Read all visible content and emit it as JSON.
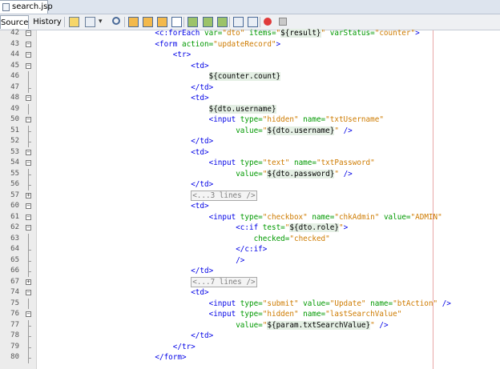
{
  "file_tab": {
    "name": "search.jsp"
  },
  "toolbar": {
    "source_label": "Source",
    "history_label": "History",
    "icons": [
      "back-icon",
      "forward-icon",
      "dropdown-icon",
      "search-icon",
      "find-previous-icon",
      "find-next-icon",
      "find-selection-icon",
      "toggle-highlight-icon",
      "prev-bookmark-icon",
      "next-bookmark-icon",
      "toggle-bookmark-icon",
      "shift-left-icon",
      "shift-right-icon",
      "record-macro-icon",
      "stop-macro-icon"
    ]
  },
  "colors": {
    "tag": "#0000e6",
    "attr": "#009900",
    "value": "#ce7b00",
    "text": "#000000",
    "el": "#000000",
    "el_bg": "#e4efe4",
    "fold_text": "#808080"
  },
  "lines": [
    {
      "num": "42",
      "fold": "-",
      "indent": 24,
      "tokens": [
        [
          "<c:forEach ",
          "tag"
        ],
        [
          "var=",
          "attr"
        ],
        [
          "\"dto\"",
          "value"
        ],
        [
          " items=",
          "attr"
        ],
        [
          "\"",
          "value"
        ],
        [
          "${result}",
          "el"
        ],
        [
          "\"",
          "value"
        ],
        [
          " varStatus=",
          "attr"
        ],
        [
          "\"counter\"",
          "value"
        ],
        [
          ">",
          "tag"
        ]
      ]
    },
    {
      "num": "43",
      "fold": "-",
      "indent": 24,
      "tokens": [
        [
          "<form ",
          "tag"
        ],
        [
          "action=",
          "attr"
        ],
        [
          "\"updateRecord\"",
          "value"
        ],
        [
          ">",
          "tag"
        ]
      ]
    },
    {
      "num": "44",
      "fold": "-",
      "indent": 28,
      "tokens": [
        [
          "<tr>",
          "tag"
        ]
      ]
    },
    {
      "num": "45",
      "fold": "-",
      "indent": 32,
      "tokens": [
        [
          "<td>",
          "tag"
        ]
      ]
    },
    {
      "num": "46",
      "fold": "",
      "indent": 36,
      "tokens": [
        [
          "${counter.count}",
          "el"
        ]
      ]
    },
    {
      "num": "47",
      "fold": "end",
      "indent": 32,
      "tokens": [
        [
          "</td>",
          "tag"
        ]
      ]
    },
    {
      "num": "48",
      "fold": "-",
      "indent": 32,
      "tokens": [
        [
          "<td>",
          "tag"
        ]
      ]
    },
    {
      "num": "49",
      "fold": "",
      "indent": 36,
      "tokens": [
        [
          "${dto.username}",
          "el"
        ]
      ]
    },
    {
      "num": "50",
      "fold": "-",
      "indent": 36,
      "tokens": [
        [
          "<input ",
          "tag"
        ],
        [
          "type=",
          "attr"
        ],
        [
          "\"hidden\"",
          "value"
        ],
        [
          " name=",
          "attr"
        ],
        [
          "\"txtUsername\"",
          "value"
        ]
      ]
    },
    {
      "num": "51",
      "fold": "end",
      "indent": 42,
      "tokens": [
        [
          "value=",
          "attr"
        ],
        [
          "\"",
          "value"
        ],
        [
          "${dto.username}",
          "el"
        ],
        [
          "\"",
          "value"
        ],
        [
          " />",
          "tag"
        ]
      ]
    },
    {
      "num": "52",
      "fold": "end",
      "indent": 32,
      "tokens": [
        [
          "</td>",
          "tag"
        ]
      ]
    },
    {
      "num": "53",
      "fold": "-",
      "indent": 32,
      "tokens": [
        [
          "<td>",
          "tag"
        ]
      ]
    },
    {
      "num": "54",
      "fold": "-",
      "indent": 36,
      "tokens": [
        [
          "<input ",
          "tag"
        ],
        [
          "type=",
          "attr"
        ],
        [
          "\"text\"",
          "value"
        ],
        [
          " name=",
          "attr"
        ],
        [
          "\"txtPassword\"",
          "value"
        ]
      ]
    },
    {
      "num": "55",
      "fold": "end",
      "indent": 42,
      "tokens": [
        [
          "value=",
          "attr"
        ],
        [
          "\"",
          "value"
        ],
        [
          "${dto.password}",
          "el"
        ],
        [
          "\"",
          "value"
        ],
        [
          " />",
          "tag"
        ]
      ]
    },
    {
      "num": "56",
      "fold": "end",
      "indent": 32,
      "tokens": [
        [
          "</td>",
          "tag"
        ]
      ]
    },
    {
      "num": "57",
      "fold": "+",
      "indent": 32,
      "tokens": [
        [
          "<...3 lines />",
          "fold_text"
        ]
      ]
    },
    {
      "num": "60",
      "fold": "-",
      "indent": 32,
      "tokens": [
        [
          "<td>",
          "tag"
        ]
      ]
    },
    {
      "num": "61",
      "fold": "-",
      "indent": 36,
      "tokens": [
        [
          "<input ",
          "tag"
        ],
        [
          "type=",
          "attr"
        ],
        [
          "\"checkbox\"",
          "value"
        ],
        [
          " name=",
          "attr"
        ],
        [
          "\"chkAdmin\"",
          "value"
        ],
        [
          " value=",
          "attr"
        ],
        [
          "\"ADMIN\"",
          "value"
        ]
      ]
    },
    {
      "num": "62",
      "fold": "-",
      "indent": 42,
      "tokens": [
        [
          "<c:if ",
          "tag"
        ],
        [
          "test=",
          "attr"
        ],
        [
          "\"",
          "value"
        ],
        [
          "${dto.role}",
          "el"
        ],
        [
          "\"",
          "value"
        ],
        [
          ">",
          "tag"
        ]
      ]
    },
    {
      "num": "63",
      "fold": "",
      "indent": 46,
      "tokens": [
        [
          "checked=",
          "attr"
        ],
        [
          "\"checked\"",
          "value"
        ]
      ]
    },
    {
      "num": "64",
      "fold": "end",
      "indent": 42,
      "tokens": [
        [
          "</c:if>",
          "tag"
        ]
      ]
    },
    {
      "num": "65",
      "fold": "end",
      "indent": 42,
      "tokens": [
        [
          "/>",
          "tag"
        ]
      ]
    },
    {
      "num": "66",
      "fold": "end",
      "indent": 32,
      "tokens": [
        [
          "</td>",
          "tag"
        ]
      ]
    },
    {
      "num": "67",
      "fold": "+",
      "indent": 32,
      "tokens": [
        [
          "<...7 lines />",
          "fold_text"
        ]
      ]
    },
    {
      "num": "74",
      "fold": "-",
      "indent": 32,
      "tokens": [
        [
          "<td>",
          "tag"
        ]
      ]
    },
    {
      "num": "75",
      "fold": "",
      "indent": 36,
      "tokens": [
        [
          "<input ",
          "tag"
        ],
        [
          "type=",
          "attr"
        ],
        [
          "\"submit\"",
          "value"
        ],
        [
          " value=",
          "attr"
        ],
        [
          "\"Update\"",
          "value"
        ],
        [
          " name=",
          "attr"
        ],
        [
          "\"btAction\"",
          "value"
        ],
        [
          " />",
          "tag"
        ]
      ]
    },
    {
      "num": "76",
      "fold": "-",
      "indent": 36,
      "tokens": [
        [
          "<input ",
          "tag"
        ],
        [
          "type=",
          "attr"
        ],
        [
          "\"hidden\"",
          "value"
        ],
        [
          " name=",
          "attr"
        ],
        [
          "\"lastSearchValue\"",
          "value"
        ]
      ]
    },
    {
      "num": "77",
      "fold": "end",
      "indent": 42,
      "tokens": [
        [
          "value=",
          "attr"
        ],
        [
          "\"",
          "value"
        ],
        [
          "${param.txtSearchValue}",
          "el"
        ],
        [
          "\"",
          "value"
        ],
        [
          " />",
          "tag"
        ]
      ]
    },
    {
      "num": "78",
      "fold": "end",
      "indent": 32,
      "tokens": [
        [
          "</td>",
          "tag"
        ]
      ]
    },
    {
      "num": "79",
      "fold": "end",
      "indent": 28,
      "tokens": [
        [
          "</tr>",
          "tag"
        ]
      ]
    },
    {
      "num": "80",
      "fold": "end",
      "indent": 24,
      "tokens": [
        [
          "</form>",
          "tag"
        ]
      ]
    }
  ]
}
